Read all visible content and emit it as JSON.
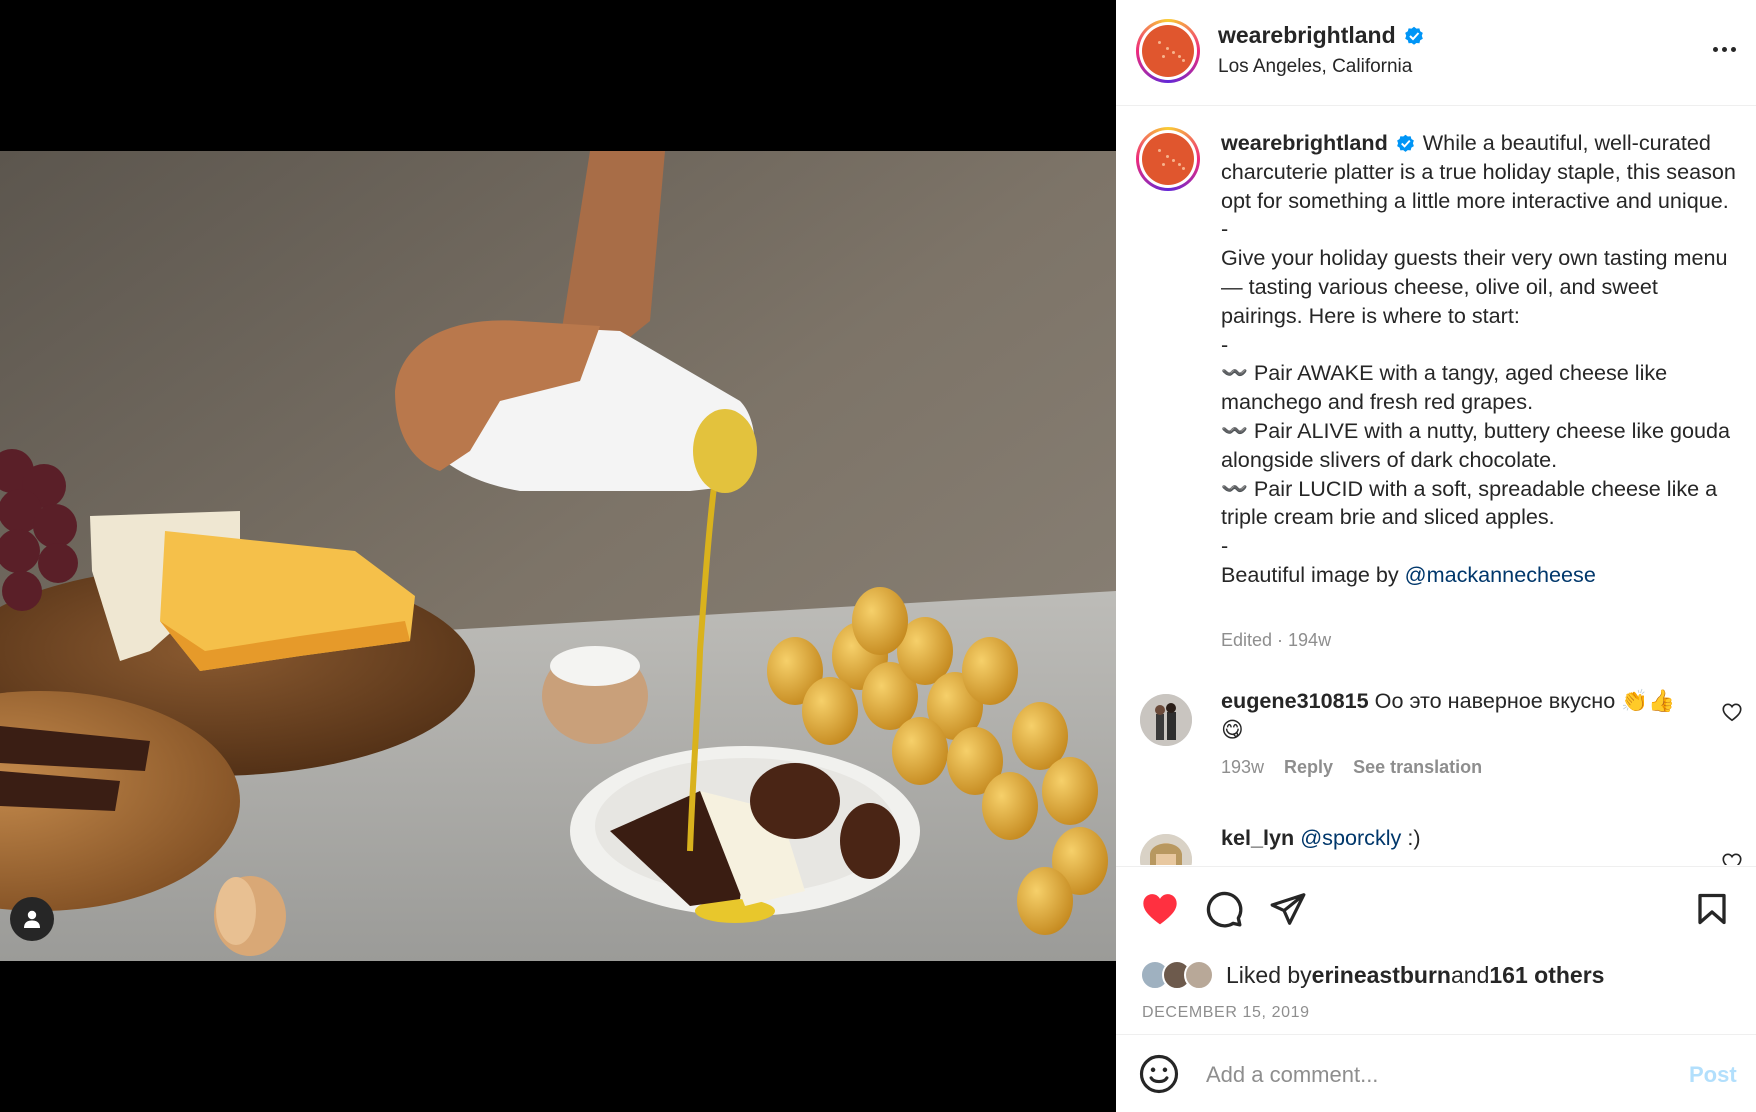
{
  "post": {
    "username": "wearebrightland",
    "location": "Los Angeles, California",
    "verified": true
  },
  "caption": {
    "username": "wearebrightland",
    "lines": [
      "While a beautiful, well-curated charcuterie platter is a true holiday staple, this season opt for something a little more interactive and unique.",
      "-",
      "Give your holiday guests their very own tasting menu — tasting various cheese, olive oil, and sweet pairings. Here is where to start:",
      "-",
      "〰️ Pair AWAKE with a tangy, aged cheese like manchego and fresh red grapes.",
      "〰️ Pair ALIVE with a nutty, buttery cheese like gouda alongside slivers of dark chocolate.",
      "〰️ Pair LUCID with a soft, spreadable cheese like a triple cream brie and sliced apples.",
      "-"
    ],
    "credit_prefix": "Beautiful image by ",
    "credit_mention": "@mackannecheese",
    "meta": "Edited · 194w"
  },
  "comments": [
    {
      "username": "eugene310815",
      "text": "Оо это наверное вкусно 👏👍😋",
      "time": "193w",
      "reply_label": "Reply",
      "translate_label": "See translation"
    },
    {
      "username": "kel_lyn",
      "mention": "@sporckly",
      "text": " :)"
    }
  ],
  "likes": {
    "prefix": "Liked by ",
    "user": "erineastburn",
    "middle": " and ",
    "others": "161 others"
  },
  "date": "DECEMBER 15, 2019",
  "add_comment": {
    "placeholder": "Add a comment...",
    "post_label": "Post"
  },
  "icons": [
    "user-tag-icon",
    "more-options-icon",
    "verified-badge-icon",
    "heart-icon",
    "comment-icon",
    "share-icon",
    "bookmark-icon",
    "emoji-icon"
  ],
  "colors": {
    "liked_heart": "#ff3040",
    "verified": "#0095f6",
    "mention": "#00376b",
    "post_disabled": "#b2dffc",
    "brand_orange": "#e0562e"
  }
}
